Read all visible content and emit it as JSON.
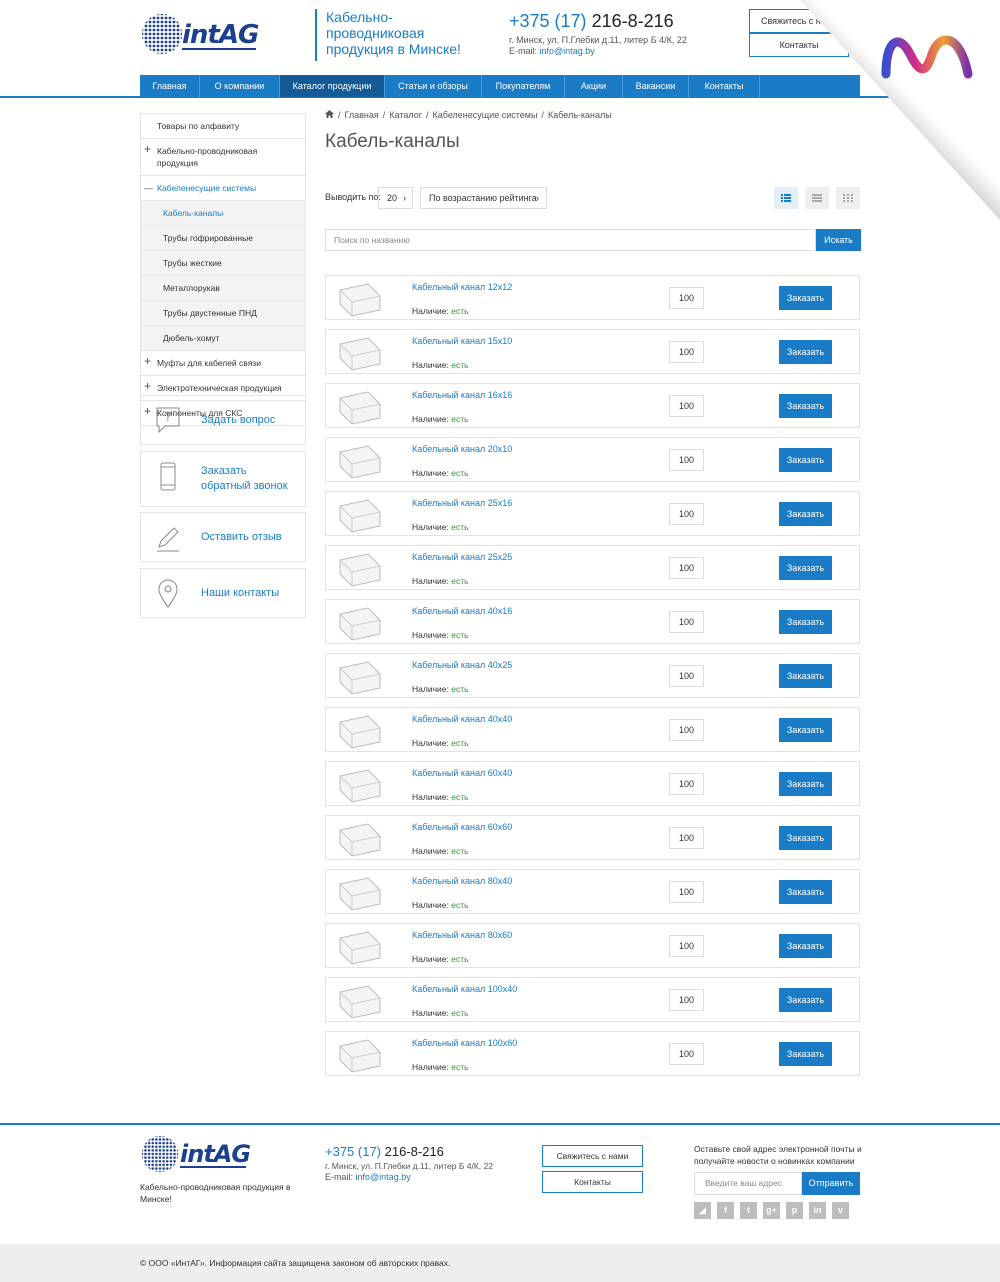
{
  "header": {
    "logo_text": "intAG",
    "tagline": "Кабельно-проводниковая продукция в Минске!",
    "phone_code": "+375 (17)",
    "phone_num": "216-8-216",
    "address": "г. Минск, ул. П.Глебки д.11, литер Б 4/К, 22",
    "email_label": "E-mail:",
    "email": "info@intag.by",
    "btn_contact": "Свяжитесь с нами",
    "btn_contacts": "Контакты"
  },
  "nav": [
    {
      "label": "Главная",
      "active": false,
      "w": 60
    },
    {
      "label": "О компании",
      "active": false,
      "w": 80
    },
    {
      "label": "Каталог продукции",
      "active": true,
      "w": 105
    },
    {
      "label": "Статьи и обзоры",
      "active": false,
      "w": 97
    },
    {
      "label": "Покупателям",
      "active": false,
      "w": 83
    },
    {
      "label": "Акции",
      "active": false,
      "w": 58
    },
    {
      "label": "Вакансии",
      "active": false,
      "w": 66
    },
    {
      "label": "Контакты",
      "active": false,
      "w": 71
    }
  ],
  "sidebar": {
    "items": [
      {
        "label": "Товары по алфавиту",
        "kind": "plain"
      },
      {
        "label": "Кабельно-проводниковая продукция",
        "kind": "plus"
      },
      {
        "label": "Кабеленесущие системы",
        "kind": "open"
      },
      {
        "label": "Кабель-каналы",
        "kind": "sub-active"
      },
      {
        "label": "Трубы гофрированные",
        "kind": "sub"
      },
      {
        "label": "Трубы жесткие",
        "kind": "sub"
      },
      {
        "label": "Металлорукав",
        "kind": "sub"
      },
      {
        "label": "Трубы двустенные ПНД",
        "kind": "sub"
      },
      {
        "label": "Дюбель-хомут",
        "kind": "sub"
      },
      {
        "label": "Муфты для кабелей связи",
        "kind": "plus"
      },
      {
        "label": "Электротехническая продукция",
        "kind": "plus"
      },
      {
        "label": "Компоненты для СКС",
        "kind": "plus"
      }
    ],
    "plus_sign": "+",
    "minus_sign": "—"
  },
  "widgets": {
    "ask": "Задать вопрос",
    "callback_1": "Заказать",
    "callback_2": "обратный звонок",
    "review": "Оставить отзыв",
    "contacts": "Наши контакты"
  },
  "breadcrumb": {
    "home_icon": "home-icon",
    "items": [
      "Главная",
      "Каталог",
      "Кабеленесущие системы",
      "Кабель-каналы"
    ],
    "sep": "/"
  },
  "page_title": "Кабель-каналы",
  "toolbar": {
    "perpage_label": "Выводить по:",
    "perpage_value": "20",
    "sort_value": "По возрастанию рейтинга"
  },
  "search": {
    "placeholder": "Поиск по названию",
    "button": "Искать"
  },
  "product_labels": {
    "avail": "Наличие:",
    "avail_value": "есть",
    "order": "Заказать"
  },
  "products": [
    {
      "name": "Кабельный канал 12x12",
      "qty": "100"
    },
    {
      "name": "Кабельный канал 15x10",
      "qty": "100"
    },
    {
      "name": "Кабельный канал 16x16",
      "qty": "100"
    },
    {
      "name": "Кабельный канал 20x10",
      "qty": "100"
    },
    {
      "name": "Кабельный канал 25x16",
      "qty": "100"
    },
    {
      "name": "Кабельный канал 25x25",
      "qty": "100"
    },
    {
      "name": "Кабельный канал 40x16",
      "qty": "100"
    },
    {
      "name": "Кабельный канал 40x25",
      "qty": "100"
    },
    {
      "name": "Кабельный канал 40x40",
      "qty": "100"
    },
    {
      "name": "Кабельный канал 60x40",
      "qty": "100"
    },
    {
      "name": "Кабельный канал 60x60",
      "qty": "100"
    },
    {
      "name": "Кабельный канал 80x40",
      "qty": "100"
    },
    {
      "name": "Кабельный канал 80x60",
      "qty": "100"
    },
    {
      "name": "Кабельный канал 100x40",
      "qty": "100"
    },
    {
      "name": "Кабельный канал 100x60",
      "qty": "100"
    }
  ],
  "footer": {
    "logo_text": "intAG",
    "tagline": "Кабельно-проводниковая продукция в Минске!",
    "phone_code": "+375 (17)",
    "phone_num": "216-8-216",
    "address": "г. Минск, ул. П.Глебки д.11, литер Б 4/К, 22",
    "email_label": "E-mail:",
    "email": "info@intag.by",
    "btn_contact": "Свяжитесь с нами",
    "btn_contacts": "Контакты",
    "newsletter_note": "Оставьте свой адрес электронной почты и получайте новости о новинках компании",
    "email_placeholder": "Введите ваш адрес",
    "send": "Отправить",
    "social": [
      "rss-icon",
      "facebook-icon",
      "twitter-icon",
      "google-plus-icon",
      "pinterest-icon",
      "linkedin-icon",
      "vimeo-icon"
    ],
    "copyright": "© ООО «ИнтАГ». Информация сайта защищена законом об авторских правах."
  },
  "colors": {
    "accent": "#1a7cc7",
    "accent_dark": "#135b96",
    "in_stock": "#2a9a2a"
  }
}
